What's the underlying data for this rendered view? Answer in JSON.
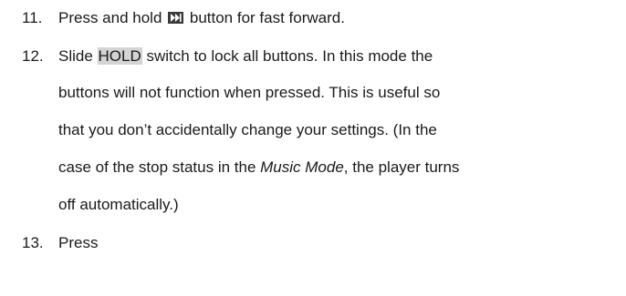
{
  "items": [
    {
      "number": "11.",
      "before_icon": "Press and hold ",
      "icon": "fast-forward-icon",
      "after_icon": " button for fast forward."
    },
    {
      "number": "12.",
      "line1_before": "Slide ",
      "line1_highlight": "HOLD",
      "line1_after": " switch to lock all buttons. In this mode the",
      "line2": "buttons will not function when pressed.    This is useful so",
      "line3": "that you don’t accidentally change your settings.    (In the",
      "line4_before": "case of the stop status in the ",
      "line4_italic": "Music Mode",
      "line4_after": ", the player turns",
      "line5": "off automatically.)"
    },
    {
      "number": "13.",
      "text": "Press"
    }
  ]
}
